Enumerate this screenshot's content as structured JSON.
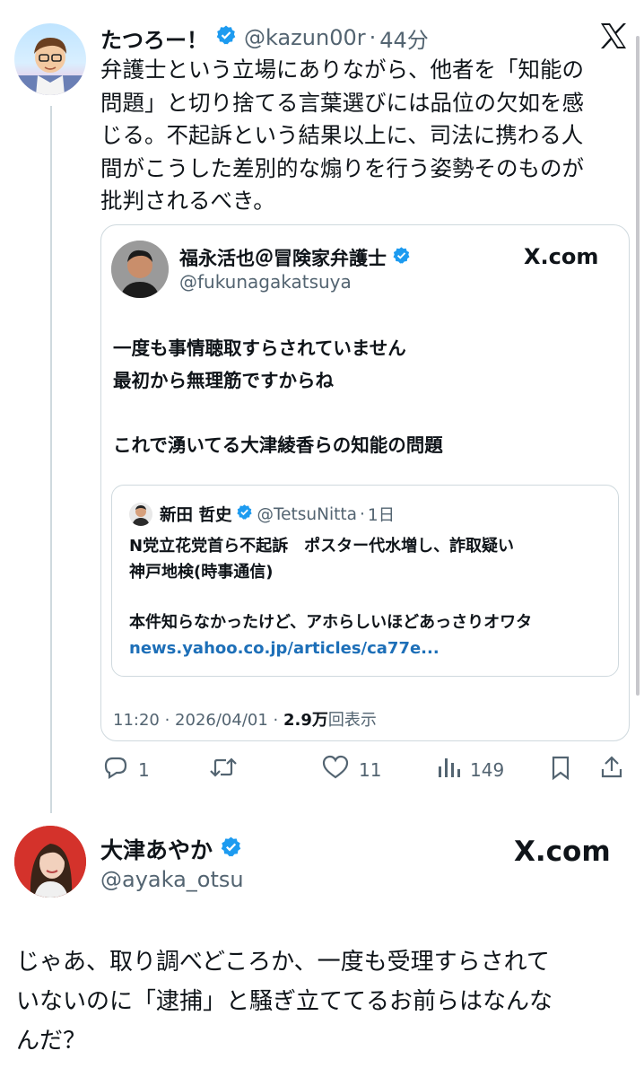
{
  "main_tweet": {
    "name": "たつろー！",
    "handle": "@kazun00r",
    "time": "44分",
    "text_lines": [
      "弁護士という立場にありながら、他者を「知能の",
      "問題」と切り捨てる言葉選びには品位の欠如を感",
      "じる。不起訴という結果以上に、司法に携わる人",
      "間がこうした差別的な煽りを行う姿勢そのものが",
      "批判されるべき。"
    ]
  },
  "quote": {
    "name": "福永活也＠冒険家弁護士",
    "handle": "@fukunagakatsuya",
    "source": "X.com",
    "lines": [
      "一度も事情聴取すらされていません",
      "最初から無理筋ですからね",
      "これで湧いてる大津綾香らの知能の問題"
    ],
    "inner": {
      "name": "新田 哲史",
      "handle": "@TetsuNitta",
      "time": "1日",
      "headline1": "N党立花党首ら不起訴　ポスター代水増し、詐取疑い",
      "headline2": "神戸地検(時事通信)",
      "comment": "本件知らなかったけど、アホらしいほどあっさりオワタ",
      "link": "news.yahoo.co.jp/articles/ca77e..."
    },
    "footer_time": "11:20 · 2026/04/01 · ",
    "views": "2.9万",
    "views_label": "回表示"
  },
  "actions": {
    "replies": "1",
    "retweets": "",
    "likes": "11",
    "views": "149"
  },
  "reply_card": {
    "name": "大津あやか",
    "handle": "@ayaka_otsu",
    "source": "X.com",
    "text_lines": [
      "じゃあ、取り調べどころか、一度も受理すらされて",
      "いないのに「逮捕」と騒ぎ立ててるお前らはなんな",
      "んだ？"
    ]
  },
  "colors": {
    "verified": "#1d9bf0",
    "link": "#1d6fb8",
    "muted": "#536471"
  }
}
